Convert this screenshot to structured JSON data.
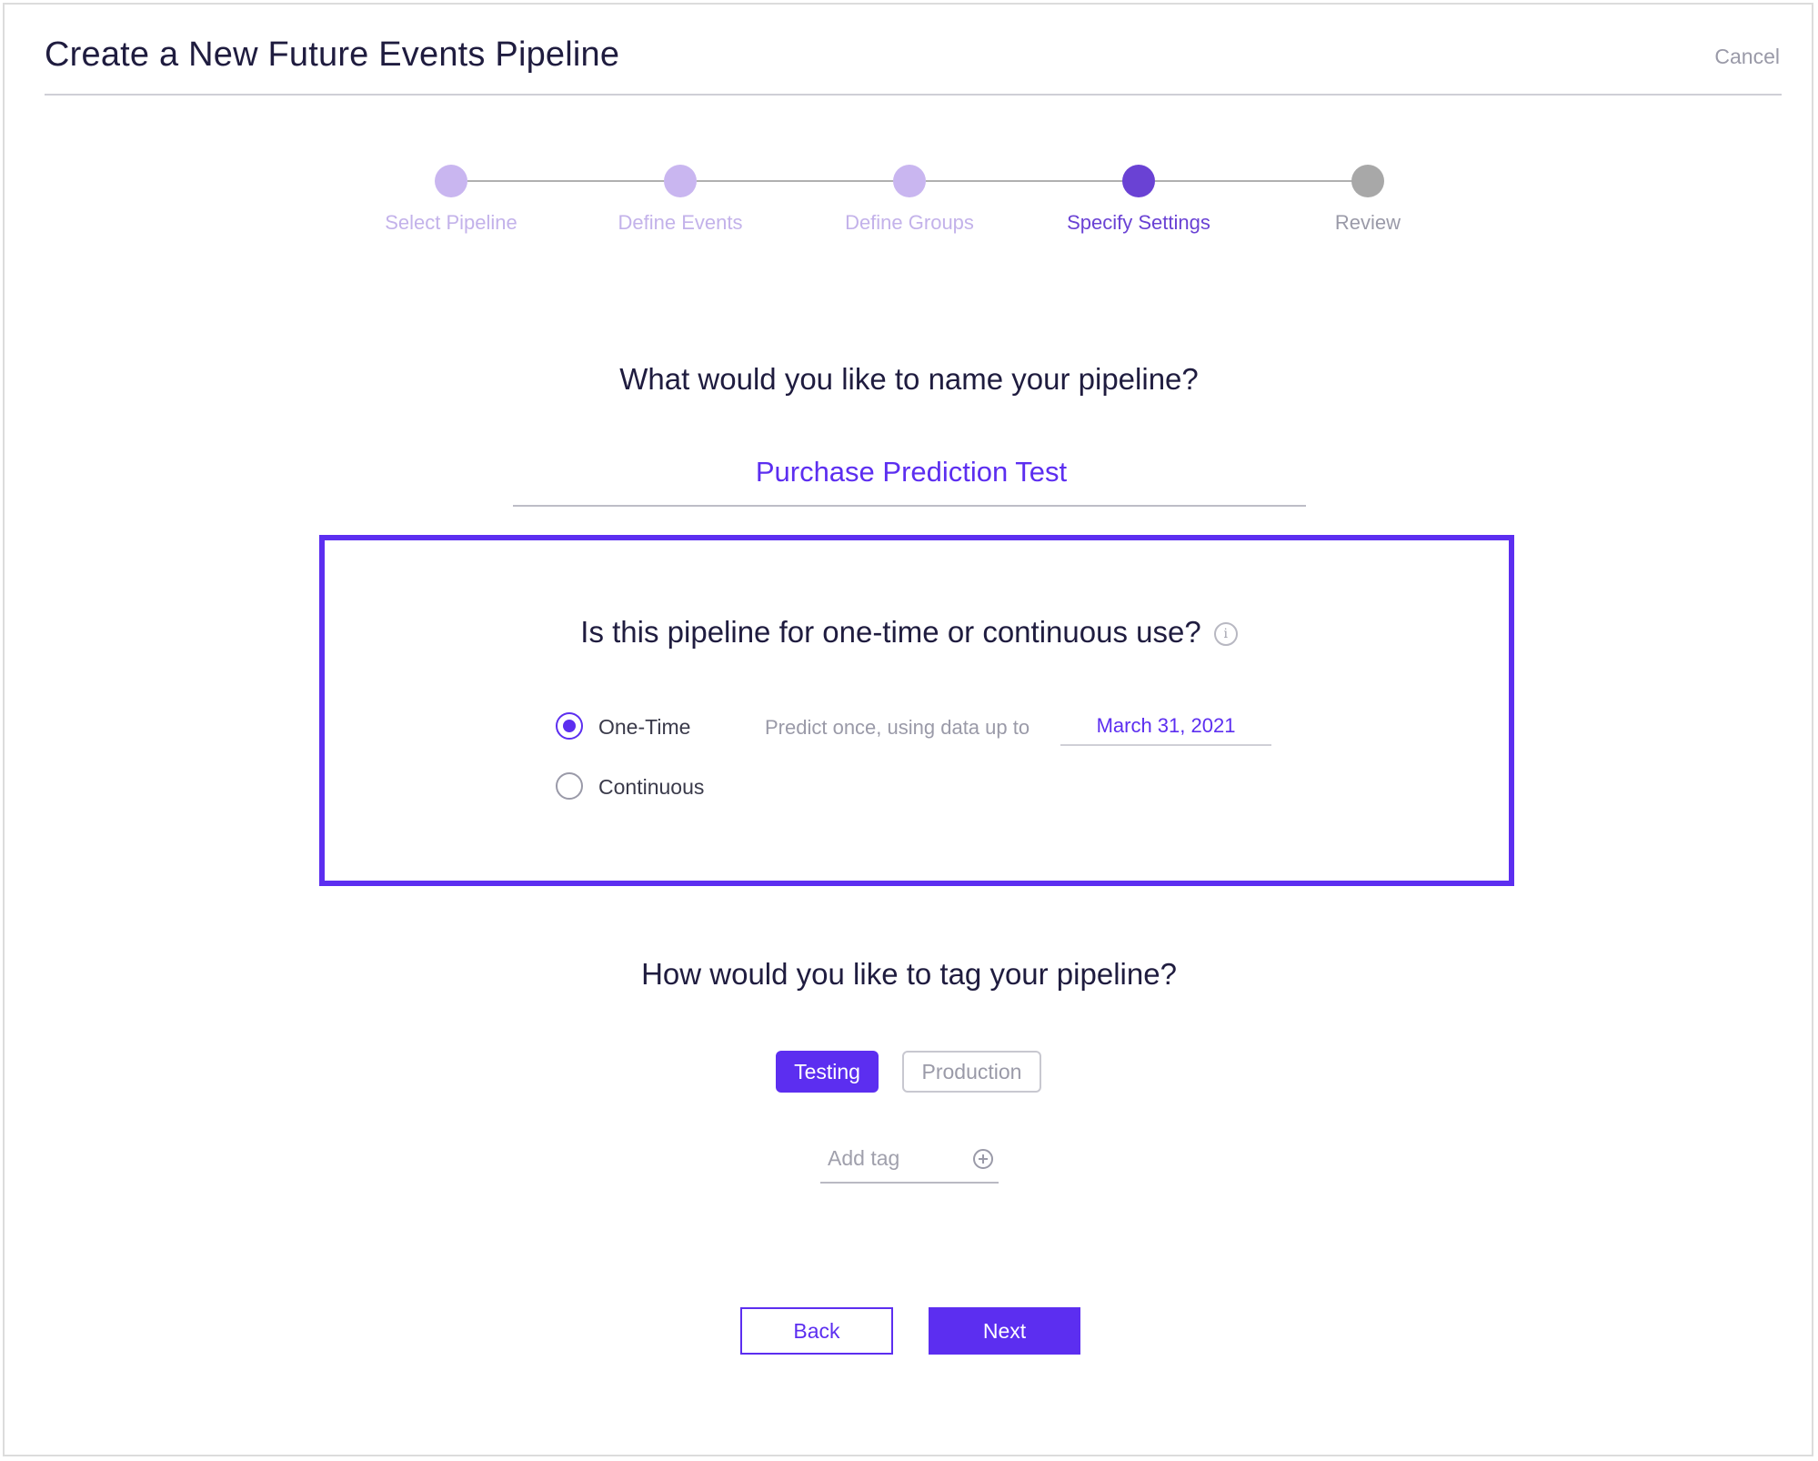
{
  "header": {
    "title": "Create a New Future Events Pipeline",
    "cancel_label": "Cancel"
  },
  "colors": {
    "accent": "#5c2ef0",
    "step_done": "#c9b6f0",
    "step_active": "#6a42d4",
    "step_pending": "#a8a8a8"
  },
  "stepper": {
    "steps": [
      {
        "label": "Select Pipeline",
        "state": "done"
      },
      {
        "label": "Define Events",
        "state": "done"
      },
      {
        "label": "Define Groups",
        "state": "done"
      },
      {
        "label": "Specify Settings",
        "state": "active"
      },
      {
        "label": "Review",
        "state": "pending"
      }
    ]
  },
  "name_section": {
    "question": "What would you like to name your pipeline?",
    "value": "Purchase Prediction Test"
  },
  "usage_section": {
    "question": "Is this pipeline for one-time or continuous use?",
    "info_icon": "info-icon",
    "options": [
      {
        "label": "One-Time",
        "selected": true
      },
      {
        "label": "Continuous",
        "selected": false
      }
    ],
    "predict_text": "Predict once, using data up to",
    "date_value": "March 31, 2021"
  },
  "tag_section": {
    "question": "How would you like to tag your pipeline?",
    "tags": [
      {
        "label": "Testing",
        "active": true
      },
      {
        "label": "Production",
        "active": false
      }
    ],
    "add_tag_placeholder": "Add tag"
  },
  "footer": {
    "back_label": "Back",
    "next_label": "Next"
  }
}
